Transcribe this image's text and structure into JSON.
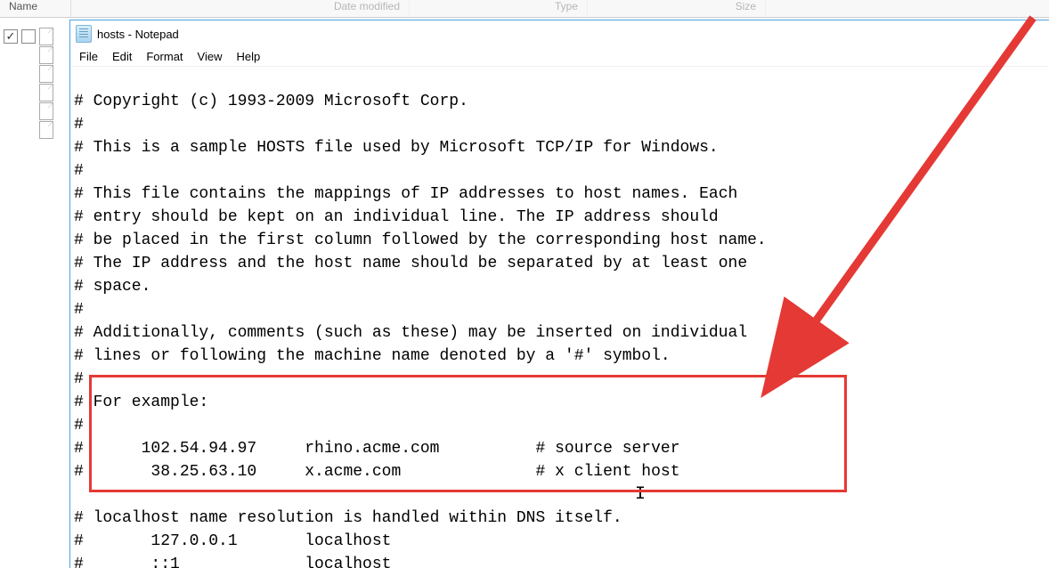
{
  "explorer": {
    "headers": [
      "Name",
      "Date modified",
      "Type",
      "Size"
    ]
  },
  "notepad": {
    "title": "hosts - Notepad",
    "menus": [
      "File",
      "Edit",
      "Format",
      "View",
      "Help"
    ],
    "lines": [
      "# Copyright (c) 1993-2009 Microsoft Corp.",
      "#",
      "# This is a sample HOSTS file used by Microsoft TCP/IP for Windows.",
      "#",
      "# This file contains the mappings of IP addresses to host names. Each",
      "# entry should be kept on an individual line. The IP address should",
      "# be placed in the first column followed by the corresponding host name.",
      "# The IP address and the host name should be separated by at least one",
      "# space.",
      "#",
      "# Additionally, comments (such as these) may be inserted on individual",
      "# lines or following the machine name denoted by a '#' symbol.",
      "#",
      "# For example:",
      "#",
      "#      102.54.94.97     rhino.acme.com          # source server",
      "#       38.25.63.10     x.acme.com              # x client host",
      "",
      "# localhost name resolution is handled within DNS itself.",
      "#       127.0.0.1       localhost",
      "#       ::1             localhost"
    ]
  }
}
